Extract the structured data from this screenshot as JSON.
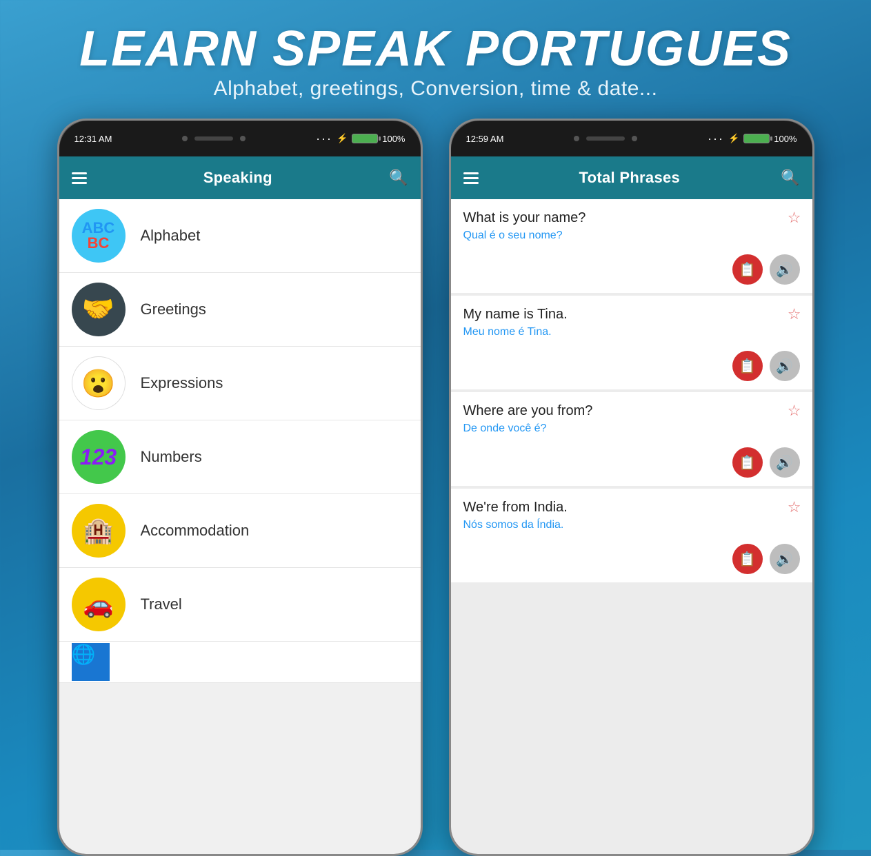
{
  "header": {
    "title": "LEARN SPEAK PORTUGUES",
    "subtitle": "Alphabet, greetings, Conversion, time & date..."
  },
  "phone_left": {
    "status_left": "12:31 AM",
    "status_right": "100%",
    "app_title": "Speaking",
    "menu_items": [
      {
        "id": "alphabet",
        "label": "Alphabet",
        "icon_type": "alphabet"
      },
      {
        "id": "greetings",
        "label": "Greetings",
        "icon_type": "greetings"
      },
      {
        "id": "expressions",
        "label": "Expressions",
        "icon_type": "expressions"
      },
      {
        "id": "numbers",
        "label": "Numbers",
        "icon_type": "numbers"
      },
      {
        "id": "accommodation",
        "label": "Accommodation",
        "icon_type": "accommodation"
      },
      {
        "id": "travel",
        "label": "Travel",
        "icon_type": "travel"
      }
    ]
  },
  "phone_right": {
    "status_left": "12:59 AM",
    "status_right": "100%",
    "app_title": "Total Phrases",
    "phrases": [
      {
        "id": "phrase-1",
        "english": "What is your name?",
        "portuguese": "Qual é o seu nome?",
        "favorited": false
      },
      {
        "id": "phrase-2",
        "english": "My name is Tina.",
        "portuguese": "Meu nome é Tina.",
        "favorited": false
      },
      {
        "id": "phrase-3",
        "english": "Where are you from?",
        "portuguese": "De onde você é?",
        "favorited": false
      },
      {
        "id": "phrase-4",
        "english": "We're from India.",
        "portuguese": "Nós somos da Índia.",
        "favorited": false
      }
    ],
    "copy_label": "📋",
    "speak_label": "🔊",
    "star_label": "☆"
  }
}
